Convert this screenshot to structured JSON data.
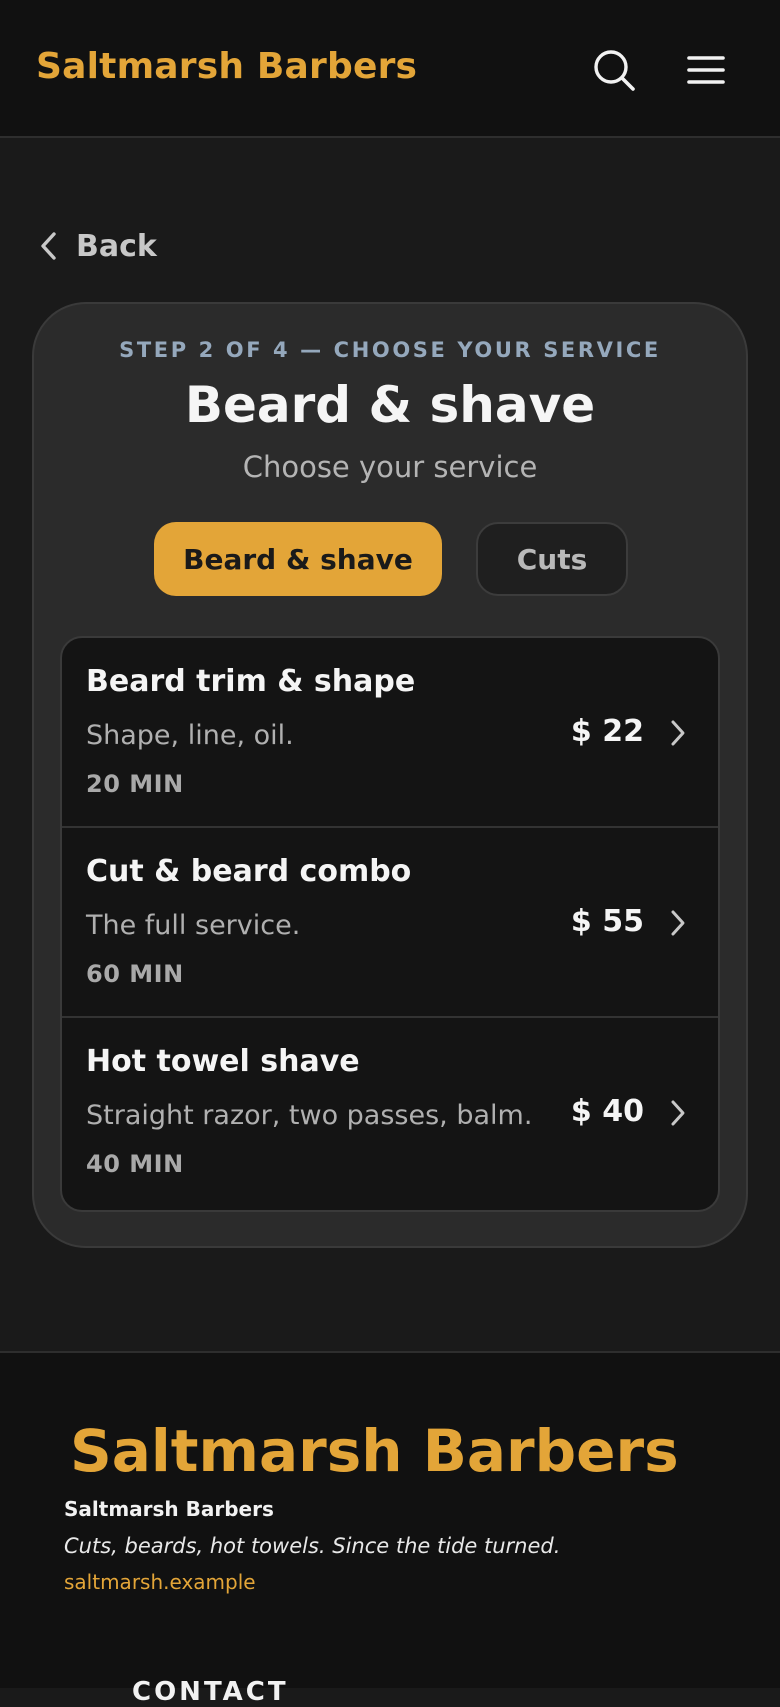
{
  "header": {
    "brand": "Saltmarsh Barbers",
    "icons": {
      "search": "search-icon",
      "menu": "hamburger-menu-icon"
    }
  },
  "back": {
    "label": "Back",
    "icon": "chevron-left-icon"
  },
  "booking": {
    "step_label": "STEP 2 OF 4 — CHOOSE YOUR SERVICE",
    "title": "Beard & shave",
    "subtitle": "Choose your service",
    "tabs": [
      {
        "label": "Beard & shave",
        "active": true
      },
      {
        "label": "Cuts",
        "active": false
      }
    ],
    "services": [
      {
        "name": "Beard trim & shape",
        "description": "Shape, line, oil.",
        "duration": "20 MIN",
        "price": "$ 22"
      },
      {
        "name": "Cut & beard combo",
        "description": "The full service.",
        "duration": "60 MIN",
        "price": "$ 55"
      },
      {
        "name": "Hot towel shave",
        "description": "Straight razor, two passes, balm.",
        "duration": "40 MIN",
        "price": "$ 40"
      }
    ]
  },
  "footer": {
    "brand": "Saltmarsh Barbers",
    "name": "Saltmarsh Barbers",
    "tagline": "Cuts, beards, hot towels. Since the tide turned.",
    "link": "saltmarsh.example",
    "contact_heading": "CONTACT"
  },
  "colors": {
    "accent": "#e3a538",
    "background": "#1a1a1a",
    "header_bg": "#111111",
    "card_bg": "#2b2b2b",
    "list_bg": "#141414",
    "step_label": "#95a8bc"
  }
}
